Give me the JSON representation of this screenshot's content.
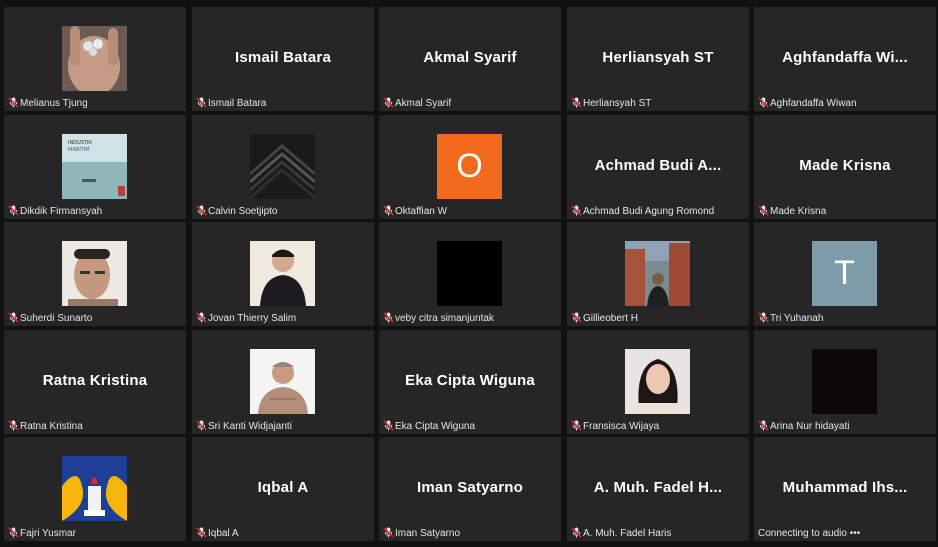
{
  "meeting": {
    "participants": [
      {
        "display": "Melianus Tjung",
        "label": "Melianus Tjung",
        "muted": true,
        "avatar": "hand-photo"
      },
      {
        "display": "Ismail Batara",
        "label": "Ismail Batara",
        "muted": true,
        "avatar": "name"
      },
      {
        "display": "Akmal Syarif",
        "label": "Akmal Syarif",
        "muted": true,
        "avatar": "name"
      },
      {
        "display": "Herliansyah ST",
        "label": "Herliansyah ST",
        "muted": true,
        "avatar": "name"
      },
      {
        "display": "Aghfandaffa  Wi...",
        "label": "Aghfandaffa Wiwan",
        "muted": true,
        "avatar": "name"
      },
      {
        "display": "Dikdik Firmansyah",
        "label": "Dikdik Firmansyah",
        "muted": true,
        "avatar": "book-cover"
      },
      {
        "display": "Calvin Soetjipto",
        "label": "Calvin Soetjipto",
        "muted": true,
        "avatar": "chevron-graphic"
      },
      {
        "display": "Oktaffian W",
        "label": "Oktaffian W",
        "muted": true,
        "avatar": "letter",
        "letter": "O",
        "color": "#f26b1d"
      },
      {
        "display": "Achmad  Budi  A...",
        "label": "Achmad Budi Agung Romond",
        "muted": true,
        "avatar": "name"
      },
      {
        "display": "Made Krisna",
        "label": "Made Krisna",
        "muted": true,
        "avatar": "name"
      },
      {
        "display": "Suherdi Sunarto",
        "label": "Suherdi Sunarto",
        "muted": true,
        "avatar": "face-photo"
      },
      {
        "display": "Jovan Thierry Salim",
        "label": "Jovan Thierry Salim",
        "muted": true,
        "avatar": "person-photo"
      },
      {
        "display": "veby citra simanjuntak",
        "label": "veby citra simanjuntak",
        "muted": true,
        "avatar": "black"
      },
      {
        "display": "Gillieobert H",
        "label": "Gillieobert H",
        "muted": true,
        "avatar": "city-photo"
      },
      {
        "display": "Tri Yuhanah",
        "label": "Tri Yuhanah",
        "muted": true,
        "avatar": "letter",
        "letter": "T",
        "color": "#7d9ba8"
      },
      {
        "display": "Ratna Kristina",
        "label": "Ratna Kristina",
        "muted": true,
        "avatar": "name"
      },
      {
        "display": "Sri Kanti Widjajanti",
        "label": "Sri Kanti Widjajanti",
        "muted": true,
        "avatar": "elder-photo"
      },
      {
        "display": "Eka Cipta Wiguna",
        "label": "Eka Cipta Wiguna",
        "muted": true,
        "avatar": "name"
      },
      {
        "display": "Fransisca Wijaya",
        "label": "Fransisca Wijaya",
        "muted": true,
        "avatar": "woman-photo"
      },
      {
        "display": "Arina Nur hidayati",
        "label": "Arina Nur hidayati",
        "muted": true,
        "avatar": "dark"
      },
      {
        "display": "Fajri Yusmar",
        "label": "Fajri Yusmar",
        "muted": true,
        "avatar": "emblem"
      },
      {
        "display": "Iqbal A",
        "label": "Iqbal A",
        "muted": true,
        "avatar": "name"
      },
      {
        "display": "Iman Satyarno",
        "label": "Iman Satyarno",
        "muted": true,
        "avatar": "name"
      },
      {
        "display": "A.  Muh.  Fadel  H...",
        "label": "A. Muh. Fadel Haris",
        "muted": true,
        "avatar": "name"
      },
      {
        "display": "Muhammad  Ihs...",
        "label": "Connecting to audio •••",
        "muted": false,
        "avatar": "name"
      }
    ]
  },
  "colors": {
    "tile": "#262626",
    "background": "#111111",
    "muted_icon": "#e02828"
  }
}
